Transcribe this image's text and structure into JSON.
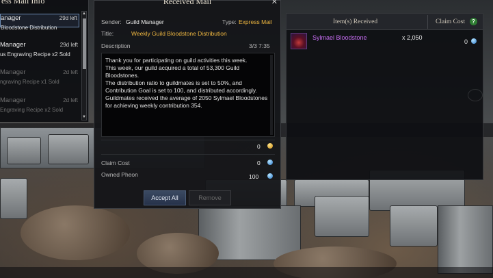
{
  "mail_list": {
    "title": "ess Mail Info",
    "items": [
      {
        "sender": "anager",
        "days": "29d left",
        "subject": "Bloodstone Distribution",
        "selected": true,
        "dim": false
      },
      {
        "sender": "Manager",
        "days": "29d left",
        "subject": "us Engraving Recipe x2 Sold",
        "selected": false,
        "dim": false
      },
      {
        "sender": "Manager",
        "days": "2d left",
        "subject": "ngraving Recipe x1 Sold",
        "selected": false,
        "dim": true
      },
      {
        "sender": "Manager",
        "days": "2d left",
        "subject": "Engraving Recipe x2 Sold",
        "selected": false,
        "dim": true
      }
    ],
    "scroll_up": "▲",
    "scroll_down": "▼"
  },
  "mail": {
    "panel_title": "Received Mail",
    "close": "✕",
    "sender_label": "Sender:",
    "sender": "Guild Manager",
    "type_label": "Type:",
    "type": "Express Mail",
    "title_label": "Title:",
    "title": "Weekly Guild Bloodstone Distribution",
    "description_label": "Description",
    "page": "3/3 7:35",
    "body": "Thank you for participating on guild activities this week.\nThis week, our guild acquired a total of 53,300 Guild Bloodstones.\nThe distribution ratio to guildmates is set to 50%, and Contribution Goal is set to 100, and distributed accordingly.\nGuildmates received the average of 2050 Sylmael Bloodstones for achieving weekly contribution 354.",
    "gold_amount": "0",
    "claim_cost_label": "Claim Cost",
    "claim_cost": "0",
    "owned_pheon_label": "Owned Pheon",
    "owned_pheon": "100",
    "accept_all": "Accept All",
    "remove": "Remove"
  },
  "items": {
    "col_received": "Item(s) Received",
    "col_claim_cost": "Claim Cost",
    "help": "?",
    "rows": [
      {
        "name": "Sylmael Bloodstone",
        "qty": "x 2,050",
        "cost": "0",
        "icon": "bloodstone-icon"
      }
    ]
  },
  "colors": {
    "gold_text": "#f0b840",
    "epic_purple": "#c56cf0",
    "accept_button": "#2f3d55"
  }
}
